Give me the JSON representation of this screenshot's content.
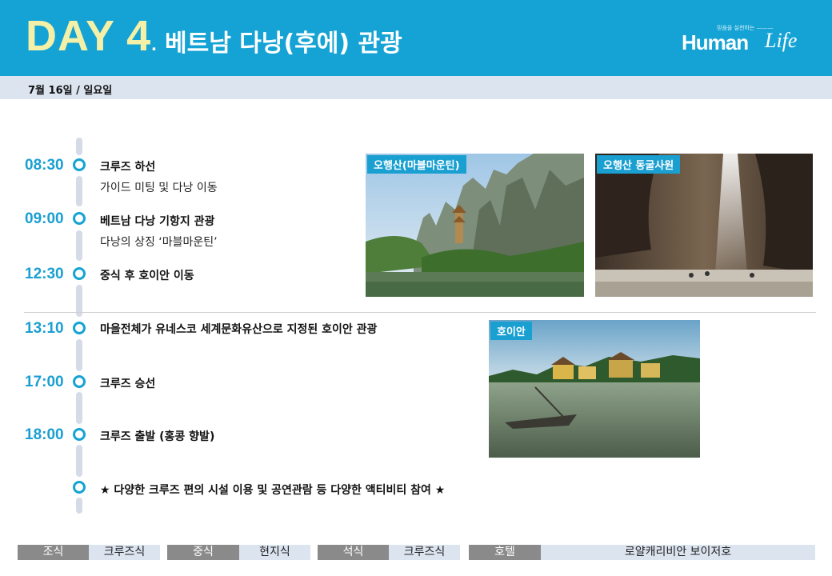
{
  "header": {
    "day_label": "DAY",
    "day_number": "4",
    "dot": ".",
    "title": "베트남 다낭(후에) 관광",
    "logo_tagline": "믿음을 실천하는 ———",
    "logo_main": "Human",
    "logo_script": "Life"
  },
  "date": "7월 16일 / 일요일",
  "schedule": [
    {
      "time": "08:30",
      "activity": "크루즈 하선",
      "detail": "가이드 미팅 및 다낭 이동"
    },
    {
      "time": "09:00",
      "activity": "베트남 다낭 기항지 관광",
      "detail": "다낭의 상징 ‘마블마운틴’"
    },
    {
      "time": "12:30",
      "activity": "중식 후 호이안 이동"
    },
    {
      "time": "13:10",
      "activity": "마을전체가 유네스코 세계문화유산으로 지정된 호이안 관광"
    },
    {
      "time": "17:00",
      "activity": "크루즈 승선"
    },
    {
      "time": "18:00",
      "activity": "크루즈 출발 (홍콩 향발)"
    }
  ],
  "note": "★ 다양한 크루즈 편의 시설 이용 및 공연관람 등 다양한 액티비티 참여 ★",
  "photos": {
    "marble": {
      "label": "오행산(마블마운틴)"
    },
    "cave": {
      "label": "오행산 동굴사원"
    },
    "hoian": {
      "label": "호이안"
    }
  },
  "meals": {
    "breakfast_label": "조식",
    "breakfast_value": "크루즈식",
    "lunch_label": "중식",
    "lunch_value": "현지식",
    "dinner_label": "석식",
    "dinner_value": "크루즈식",
    "hotel_label": "호텔",
    "hotel_value": "로얄캐리비안 보이저호"
  },
  "colors": {
    "header_blue": "#14a3d4",
    "day_yellow": "#f4f0a8",
    "time_blue": "#1a9fd1",
    "bar_gray": "#8a8a8a",
    "bar_light": "#dce4f0"
  }
}
